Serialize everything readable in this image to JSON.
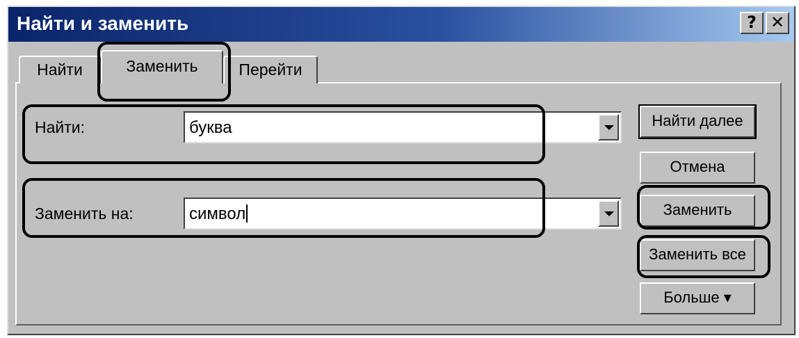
{
  "window": {
    "title": "Найти и заменить",
    "help_label": "?",
    "close_label": "✕"
  },
  "tabs": [
    {
      "label": "Найти",
      "selected": false
    },
    {
      "label": "Заменить",
      "selected": true
    },
    {
      "label": "Перейти",
      "selected": false
    }
  ],
  "find": {
    "label": "Найти:",
    "value": "буква"
  },
  "replace": {
    "label": "Заменить на:",
    "value": "символ"
  },
  "buttons": {
    "find_next": "Найти далее",
    "cancel": "Отмена",
    "replace": "Заменить",
    "replace_all": "Заменить все",
    "more": "Больше ▾"
  },
  "icons": {
    "dropdown": "chevron-down-icon",
    "help": "help-icon",
    "close": "close-icon"
  },
  "colors": {
    "titlebar_start": "#0a246a",
    "titlebar_end": "#a6caf0",
    "face": "#c0c0c0",
    "highlight_outline": "#000000"
  }
}
